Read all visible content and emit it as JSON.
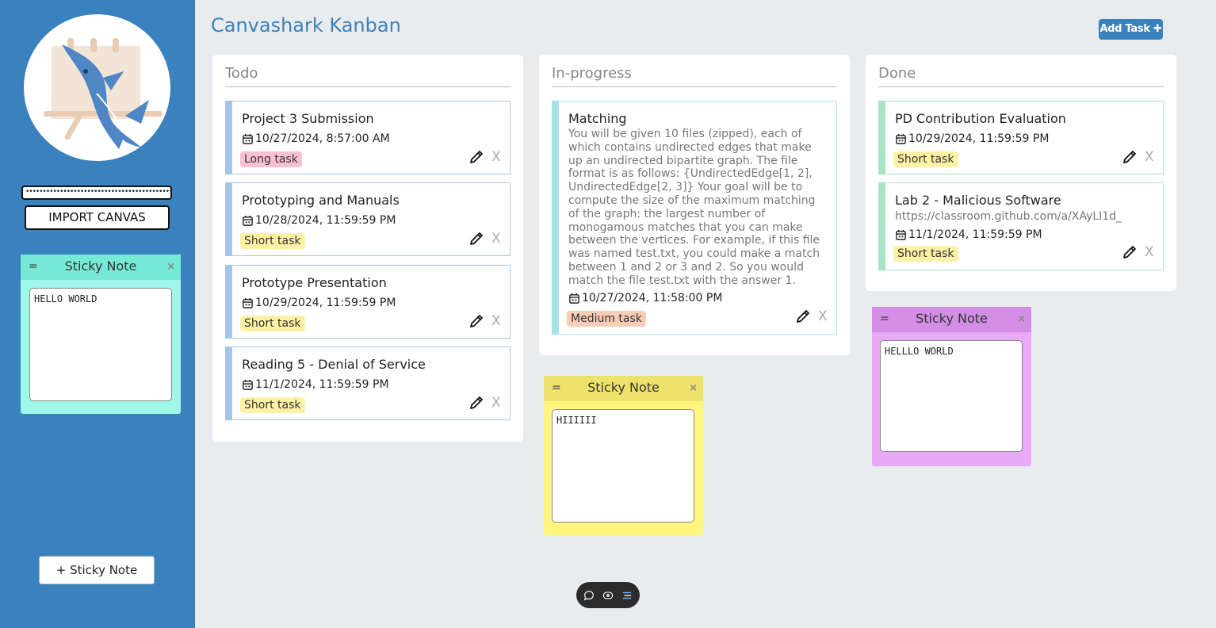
{
  "app": {
    "title": "Canvashark Kanban",
    "add_task_label": "Add Task ✚"
  },
  "sidebar": {
    "logo_icon": "shark-easel-logo",
    "token_value": "••••••••••••••••••••••••••••••••••••••••••••",
    "import_label": "IMPORT CANVAS",
    "add_sticky_label": "+ Sticky Note"
  },
  "columns": [
    {
      "title": "Todo",
      "cards": [
        {
          "title": "Project 3 Submission",
          "date": "10/27/2024, 8:57:00 AM",
          "tag": "Long task"
        },
        {
          "title": "Prototyping and Manuals",
          "date": "10/28/2024, 11:59:59 PM",
          "tag": "Short task"
        },
        {
          "title": "Prototype Presentation",
          "date": "10/29/2024, 11:59:59 PM",
          "tag": "Short task"
        },
        {
          "title": "Reading 5 - Denial of Service",
          "date": "11/1/2024, 11:59:59 PM",
          "tag": "Short task"
        }
      ]
    },
    {
      "title": "In-progress",
      "cards": [
        {
          "title": "Matching",
          "description": "You will be given 10 files (zipped), each of which contains undirected edges that make up an undirected bipartite graph. The file format is as follows: {UndirectedEdge[1, 2], UndirectedEdge[2, 3]} Your goal will be to compute the size of the maximum matching of the graph: the largest number of monogamous matches that you can make between the vertices. For example, if this file was named test.txt, you could make a match between 1 and 2 or 3 and 2. So you would match the file test.txt with the answer 1.",
          "date": "10/27/2024, 11:58:00 PM",
          "tag": "Medium task"
        }
      ]
    },
    {
      "title": "Done",
      "cards": [
        {
          "title": "PD Contribution Evaluation",
          "date": "10/29/2024, 11:59:59 PM",
          "tag": "Short task"
        },
        {
          "title": "Lab 2 - Malicious Software",
          "link": "https://classroom.github.com/a/XAyLI1d_",
          "date": "11/1/2024, 11:59:59 PM",
          "tag": "Short task"
        }
      ]
    }
  ],
  "card_actions": {
    "delete_label": "X",
    "edit_icon": "pencil-icon",
    "date_icon": "calendar-icon"
  },
  "sticky_notes": [
    {
      "title": "Sticky Note",
      "handle": "=",
      "close": "×",
      "text": "HELLO WORLD",
      "color": "#9ff7ea",
      "header_color": "#76ead6"
    },
    {
      "title": "Sticky Note",
      "handle": "=",
      "close": "×",
      "text": "HIIIIII",
      "color": "#fff57f",
      "header_color": "#eee36a"
    },
    {
      "title": "Sticky Note",
      "handle": "=",
      "close": "×",
      "text": "HELLLO WORLD",
      "color": "#e8a9f6",
      "header_color": "#d58ee6"
    }
  ],
  "colors": {
    "sidebar": "#3a82bd",
    "todo_accent": "#a2c6e6",
    "inprogress_accent": "#a7e1e8",
    "done_accent": "#a7e6c4",
    "long_tag": "#f7c1d3",
    "short_tag": "#fdf1a6",
    "medium_tag": "#f8cdb5"
  },
  "toolbar": {
    "icons": [
      "comment-icon",
      "eye-icon",
      "menu-icon"
    ]
  }
}
